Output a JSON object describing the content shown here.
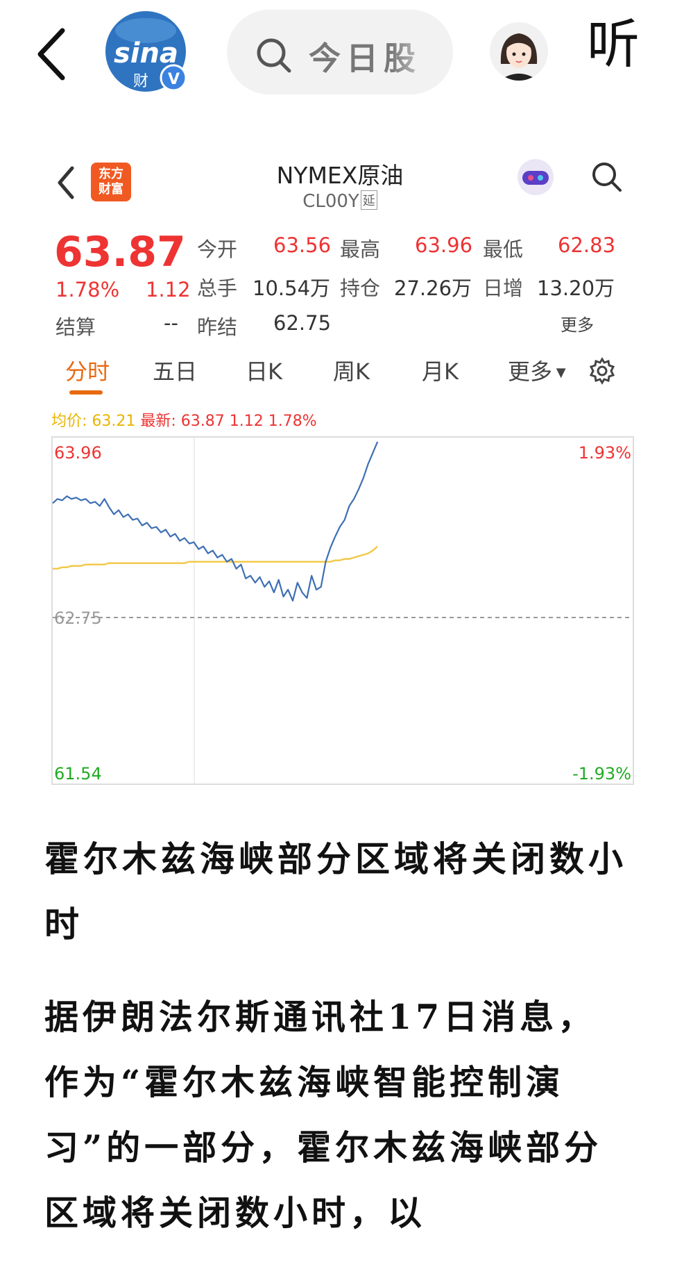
{
  "topbar": {
    "search_placeholder": "今日股",
    "listen_label": "听",
    "logo_text": "sina",
    "logo_sub": "财",
    "verified_mark": "V"
  },
  "quote_card": {
    "brand_badge": "东方\n财富",
    "title": "NYMEX原油",
    "code": "CL00Y",
    "delay_tag": "延",
    "price": "63.87",
    "change_pct": "1.78%",
    "change": "1.12",
    "fields": {
      "open_label": "今开",
      "open_value": "63.56",
      "high_label": "最高",
      "high_value": "63.96",
      "low_label": "最低",
      "low_value": "62.83",
      "volume_label": "总手",
      "volume_value": "10.54万",
      "oi_label": "持仓",
      "oi_value": "27.26万",
      "daily_inc_label": "日增",
      "daily_inc_value": "13.20万",
      "settle_label": "结算",
      "settle_value": "--",
      "prev_settle_label": "昨结",
      "prev_settle_value": "62.75"
    },
    "more_label": "更多",
    "tabs": [
      "分时",
      "五日",
      "日K",
      "周K",
      "月K",
      "更多"
    ],
    "active_tab": 0,
    "legend": {
      "avg_text": "均价: 63.21",
      "latest_text": "最新: 63.87 1.12 1.78%"
    },
    "colors": {
      "up": "#e33333",
      "down": "#22a03c",
      "avg_line": "#f2c94c",
      "price_line": "#3d6fb4",
      "accent": "#e86a10"
    }
  },
  "chart_data": {
    "type": "line",
    "y_top_label": "63.96",
    "y_mid_label": "62.75",
    "y_bottom_label": "61.54",
    "pct_top_label": "1.93%",
    "pct_bottom_label": "-1.93%",
    "ylim": [
      61.54,
      63.96
    ],
    "baseline": 62.75,
    "session_fraction_shown": 0.56,
    "series": [
      {
        "values": [
          63.52,
          63.55,
          63.54,
          63.57,
          63.55,
          63.56,
          63.54,
          63.55,
          63.52,
          63.53,
          63.5,
          63.55,
          63.49,
          63.44,
          63.47,
          63.42,
          63.44,
          63.4,
          63.41,
          63.36,
          63.38,
          63.34,
          63.35,
          63.31,
          63.33,
          63.28,
          63.3,
          63.25,
          63.27,
          63.23,
          63.24,
          63.19,
          63.21,
          63.16,
          63.18,
          63.13,
          63.15,
          63.1,
          63.12,
          63.05,
          63.08,
          62.98,
          63.0,
          62.95,
          62.99,
          62.92,
          62.96,
          62.88,
          62.97,
          62.85,
          62.9,
          62.82,
          62.95,
          62.88,
          62.84,
          63.0,
          62.9,
          62.92,
          63.1,
          63.2,
          63.28,
          63.35,
          63.4,
          63.5,
          63.55,
          63.62,
          63.7,
          63.8,
          63.88,
          63.96
        ]
      },
      {
        "values": [
          63.05,
          63.05,
          63.06,
          63.06,
          63.07,
          63.07,
          63.07,
          63.08,
          63.08,
          63.08,
          63.08,
          63.08,
          63.09,
          63.09,
          63.09,
          63.09,
          63.09,
          63.09,
          63.09,
          63.09,
          63.09,
          63.09,
          63.09,
          63.09,
          63.09,
          63.09,
          63.09,
          63.09,
          63.09,
          63.1,
          63.1,
          63.1,
          63.1,
          63.1,
          63.1,
          63.1,
          63.1,
          63.1,
          63.1,
          63.1,
          63.1,
          63.1,
          63.1,
          63.1,
          63.1,
          63.1,
          63.1,
          63.1,
          63.1,
          63.1,
          63.1,
          63.1,
          63.1,
          63.1,
          63.1,
          63.1,
          63.1,
          63.1,
          63.1,
          63.1,
          63.11,
          63.11,
          63.12,
          63.12,
          63.13,
          63.14,
          63.15,
          63.16,
          63.18,
          63.21
        ]
      }
    ]
  },
  "article": {
    "headline": "霍尔木兹海峡部分区域将关闭数小时",
    "body": "据伊朗法尔斯通讯社17日消息，作为“霍尔木兹海峡智能控制演习”的一部分，霍尔木兹海峡部分区域将关闭数小时，以"
  }
}
